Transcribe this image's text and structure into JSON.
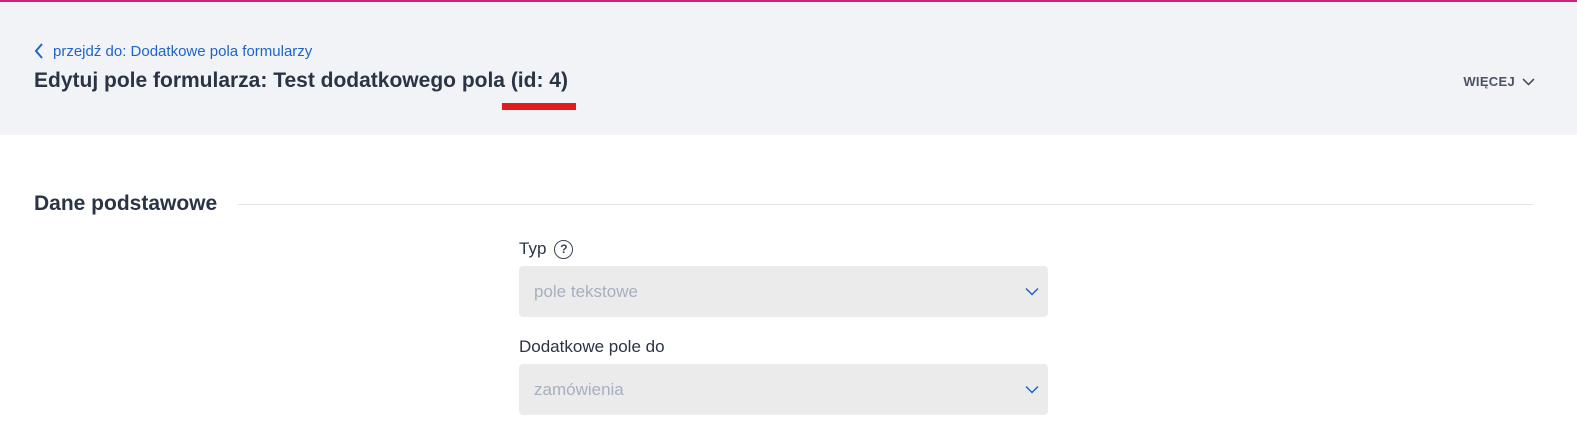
{
  "header": {
    "back_link": "przejdź do: Dodatkowe pola formularzy",
    "title": "Edytuj pole formularza: Test dodatkowego pola (id: 4)",
    "more_button": "WIĘCEJ",
    "accent_color": "#c8257a",
    "link_color": "#1f64c8"
  },
  "section": {
    "title": "Dane podstawowe"
  },
  "fields": [
    {
      "label": "Typ",
      "help_icon": "question-circle-icon",
      "value": "pole tekstowe",
      "disabled": true
    },
    {
      "label": "Dodatkowe pole do",
      "value": "zamówienia",
      "disabled": true
    }
  ],
  "icons": {
    "back": "chevron-left-icon",
    "more": "chevron-down-icon",
    "select": "chevron-down-icon"
  }
}
